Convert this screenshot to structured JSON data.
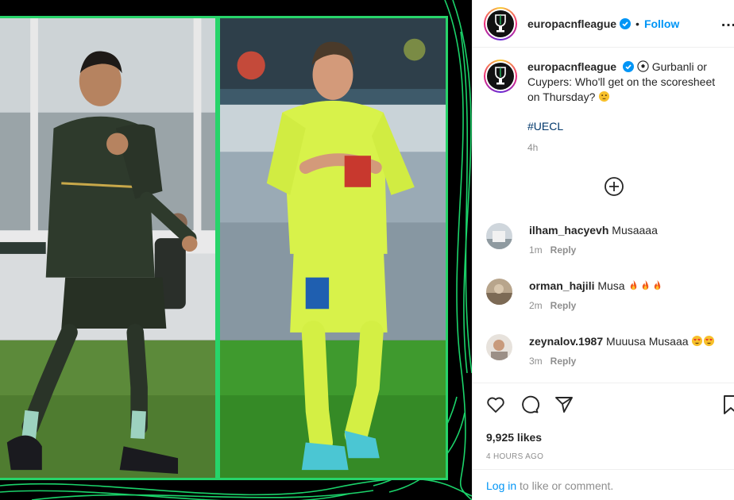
{
  "header": {
    "username": "europacnfleague",
    "dot": "•",
    "follow_label": "Follow",
    "more_label": "…"
  },
  "caption": {
    "username": "europacnfleague",
    "text": "Gurbanli or Cuypers: Who'll get on the scoresheet on Thursday?",
    "hashtag": "#UECL",
    "time": "4h"
  },
  "comments": [
    {
      "username": "ilham_hacyevh",
      "text": "Musaaaa",
      "time": "1m",
      "reply": "Reply"
    },
    {
      "username": "orman_hajili",
      "text": "Musa",
      "time": "2m",
      "reply": "Reply"
    },
    {
      "username": "zeynalov.1987",
      "text": "Muuusa Musaaa",
      "time": "3m",
      "reply": "Reply"
    }
  ],
  "footer": {
    "likes": "9,925 likes",
    "timestamp": "4 HOURS AGO",
    "login_link": "Log in",
    "login_rest": " to like or comment."
  },
  "icons": {
    "verified": "verified-badge-icon",
    "like": "heart-icon",
    "comment": "comment-bubble-icon",
    "share": "paper-plane-icon",
    "save": "bookmark-icon",
    "load_more": "plus-circle-icon"
  },
  "colors": {
    "accent_blue": "#0095f6",
    "frame_green": "#27d46a",
    "hashtag": "#00376b",
    "muted": "#8e8e8e"
  }
}
